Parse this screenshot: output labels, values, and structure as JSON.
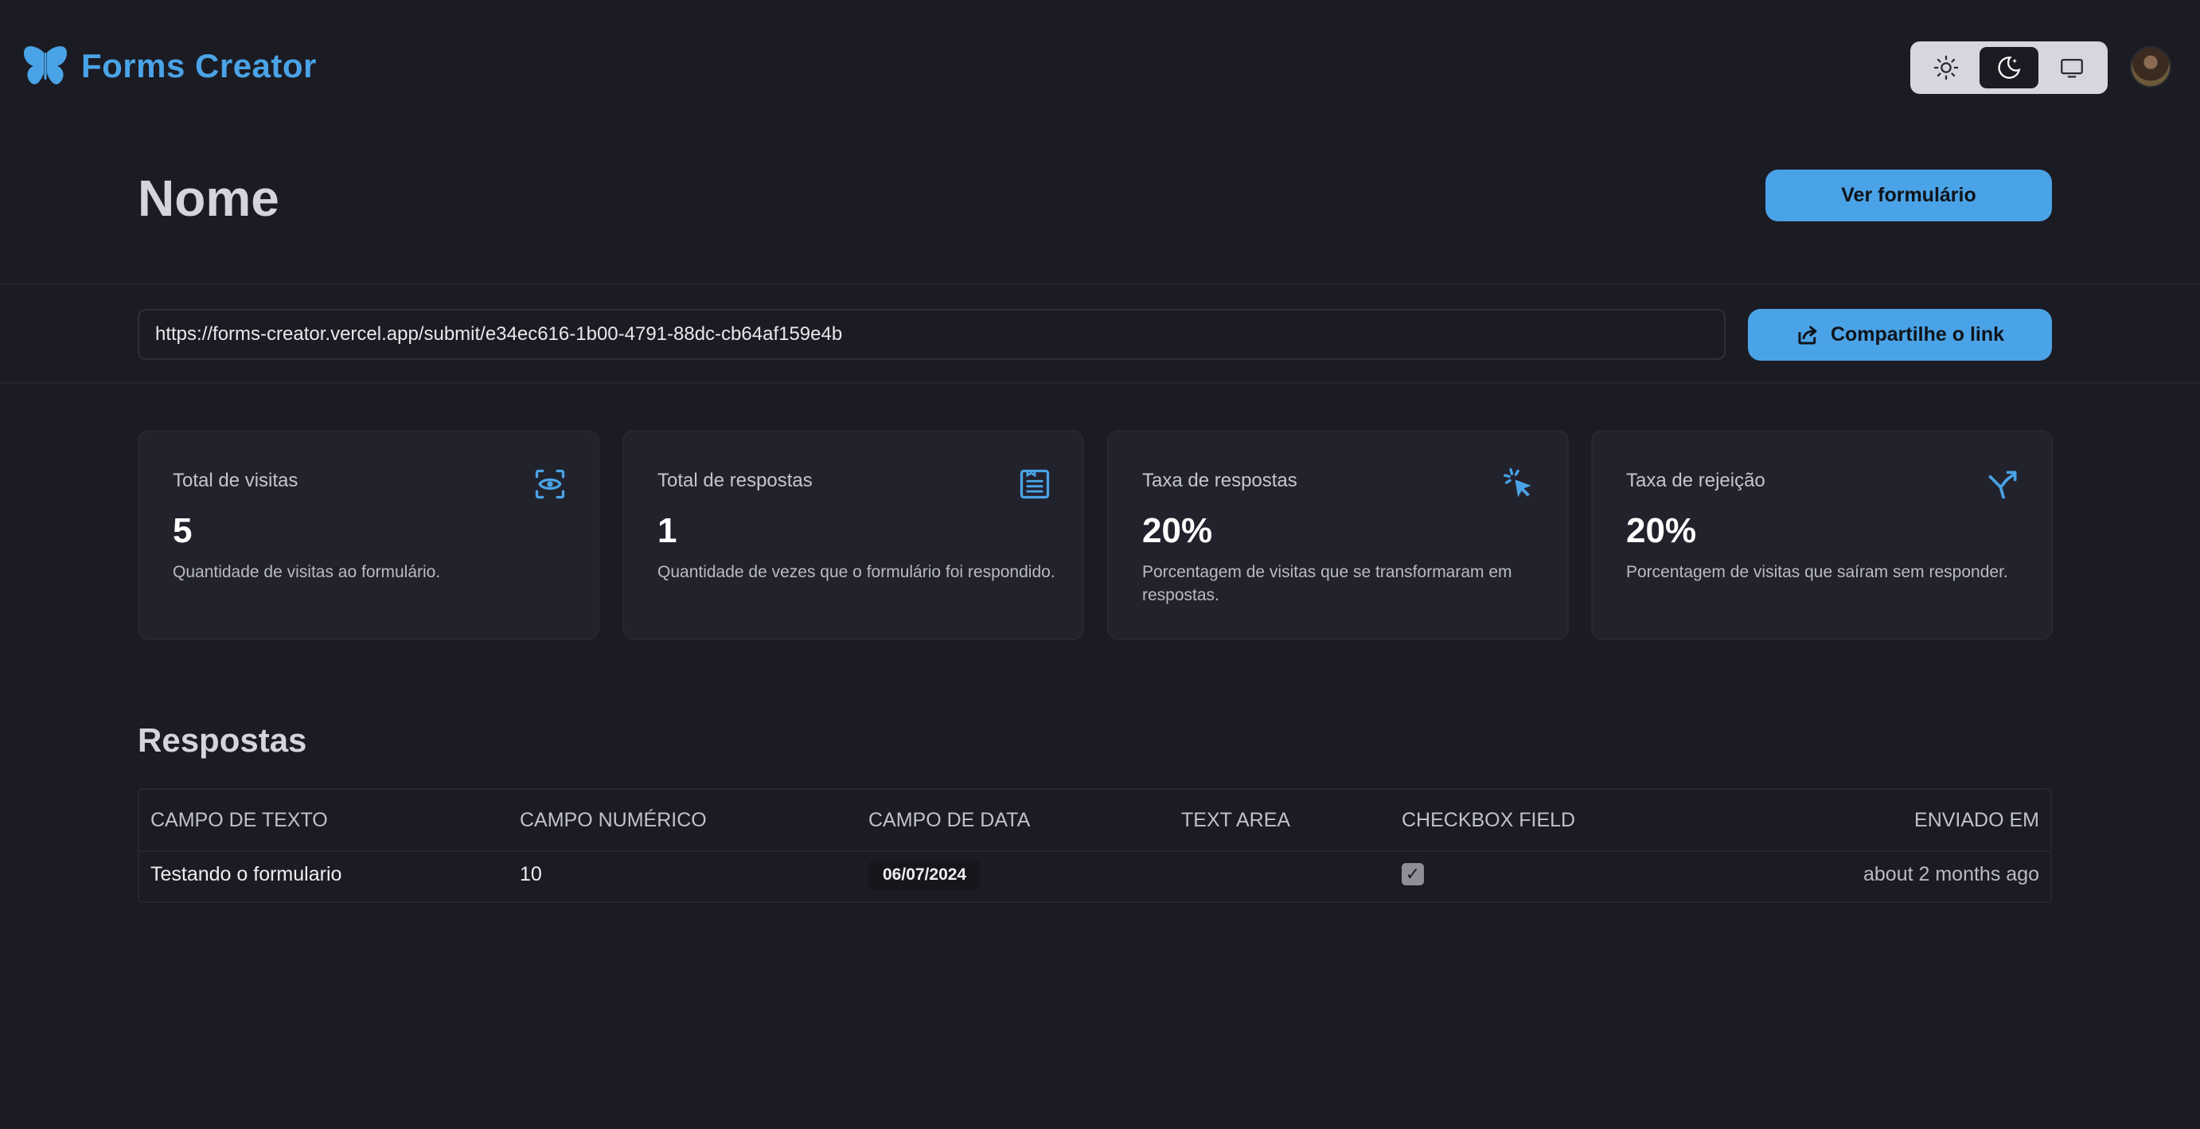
{
  "app": {
    "name": "Forms Creator"
  },
  "header": {
    "theme_options": [
      {
        "icon": "sun-icon",
        "active": false
      },
      {
        "icon": "moon-icon",
        "active": true
      },
      {
        "icon": "monitor-icon",
        "active": false
      }
    ]
  },
  "page": {
    "title": "Nome",
    "view_form_label": "Ver formulário",
    "share_link_value": "https://forms-creator.vercel.app/submit/e34ec616-1b00-4791-88dc-cb64af159e4b",
    "share_button_label": "Compartilhe o link"
  },
  "stats": [
    {
      "label": "Total de visitas",
      "value": "5",
      "description": "Quantidade de visitas ao formulário.",
      "icon": "eye-icon"
    },
    {
      "label": "Total de respostas",
      "value": "1",
      "description": "Quantidade de vezes que o formulário foi respondido.",
      "icon": "form-list-icon"
    },
    {
      "label": "Taxa de respostas",
      "value": "20%",
      "description": "Porcentagem de visitas que se transformaram em respostas.",
      "icon": "cursor-click-icon"
    },
    {
      "label": "Taxa de rejeição",
      "value": "20%",
      "description": "Porcentagem de visitas que saíram sem responder.",
      "icon": "split-arrow-icon"
    }
  ],
  "responses": {
    "title": "Respostas",
    "columns": [
      "Campo de texto",
      "Campo Numérico",
      "Campo de data",
      "Text area",
      "Checkbox field",
      "Enviado em"
    ],
    "rows": [
      {
        "text": "Testando o formulario",
        "number": "10",
        "date": "06/07/2024",
        "textarea": "",
        "checkbox": true,
        "sent": "about 2 months ago"
      }
    ]
  },
  "colors": {
    "accent": "#4aa3e6",
    "background": "#1b1b23",
    "card": "#22222d"
  }
}
